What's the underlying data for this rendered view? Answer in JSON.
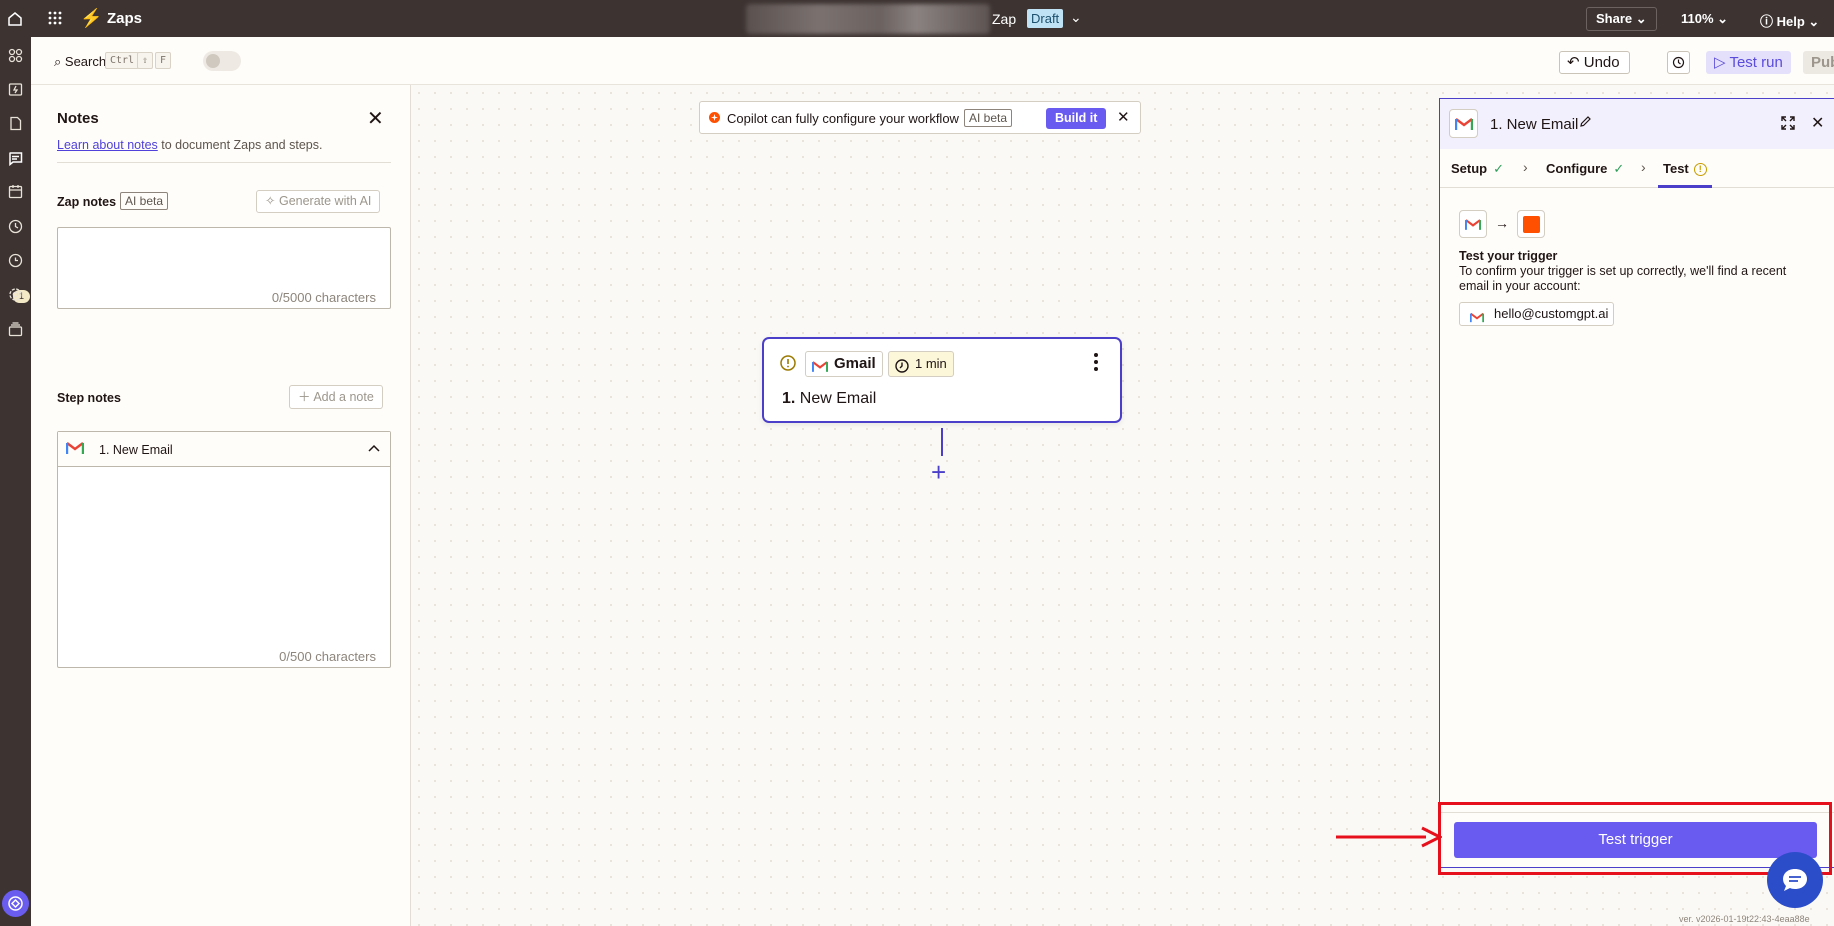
{
  "topbar": {
    "app_name": "Zaps",
    "zap_name_suffix": "Zap",
    "status_badge": "Draft",
    "share_label": "Share",
    "zoom_level": "110%",
    "help_label": "Help"
  },
  "rail": {
    "notification_count": "1"
  },
  "toolbar": {
    "search_label": "Search",
    "shortcut_keys": [
      "Ctrl",
      "⇧",
      "F"
    ],
    "undo_label": "Undo",
    "test_run_label": "Test run",
    "publish_label": "Publish"
  },
  "notes": {
    "title": "Notes",
    "learn_link": "Learn about notes",
    "learn_suffix": " to document Zaps and steps.",
    "zap_notes_label": "Zap notes",
    "ai_beta_label": "AI beta",
    "generate_label": "Generate with AI",
    "zap_notes_count": "0/5000 characters",
    "step_notes_label": "Step notes",
    "add_note_label": "Add a note",
    "step_title": "1. New Email",
    "step_notes_count": "0/500 characters"
  },
  "copilot": {
    "text": "Copilot can fully configure your workflow",
    "badge": "AI beta",
    "build_label": "Build it",
    "close_label": "✕"
  },
  "node": {
    "app": "Gmail",
    "duration": "1 min",
    "step_number": "1.",
    "step_name": "New Email"
  },
  "panel": {
    "title": "1. New Email",
    "tabs": [
      {
        "label": "Setup",
        "status": "✓"
      },
      {
        "label": "Configure",
        "status": "✓"
      },
      {
        "label": "Test",
        "status": "!"
      }
    ],
    "test_title": "Test your trigger",
    "test_description": "To confirm your trigger is set up correctly, we'll find a recent email in your account:",
    "account_email": "hello@customgpt.ai",
    "test_button_label": "Test trigger"
  },
  "footer": {
    "version": "ver. v2026-01-19t22:43-4eaa88e"
  },
  "colors": {
    "brand_orange": "#ff4f00",
    "accent_purple": "#6a5bf0",
    "highlight_red": "#e5101c",
    "dark_bar": "#3d3432"
  }
}
